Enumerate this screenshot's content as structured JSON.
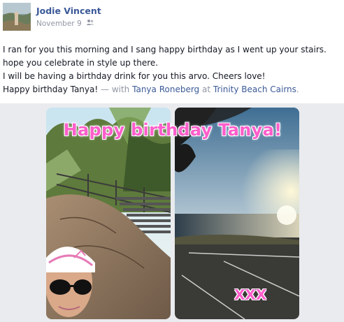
{
  "post": {
    "author": "Jodie Vincent",
    "date": "November 9",
    "privacy_icon": "friends-icon",
    "body": {
      "line1": "I ran for you this morning and I sang happy birthday as I went up your stairs.",
      "line2": "hope you celebrate in style up there.",
      "line3": "I will be having a birthday drink for you this arvo. Cheers love!",
      "line4_prefix": "Happy birthday Tanya!",
      "line4_with": "— with",
      "tagged_person": "Tanya Roneberg",
      "at": "at",
      "location": "Trinity Beach Cairns",
      "period": "."
    },
    "photo_overlay": {
      "title": "Happy birthday Tanya!",
      "signoff": "XXX"
    }
  }
}
